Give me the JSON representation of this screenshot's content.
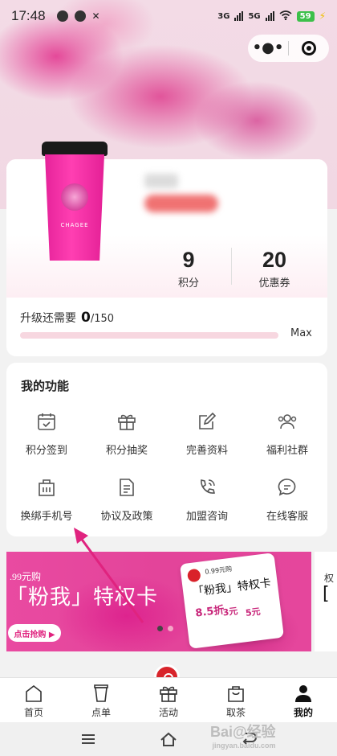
{
  "status_bar": {
    "time": "17:48",
    "net1": "3G",
    "net2": "5G",
    "battery": "59"
  },
  "capsule": {
    "more_glyph": "•●•"
  },
  "member": {
    "cup_brand": "CHAGEE",
    "points_value": "9",
    "points_label": "积分",
    "coupons_value": "20",
    "coupons_label": "优惠券",
    "upgrade_label": "升级还需要",
    "upgrade_current": "0",
    "upgrade_total": "/150",
    "progress_fraction": 0,
    "max_label": "Max"
  },
  "functions": {
    "title": "我的功能",
    "items": [
      {
        "label": "积分签到",
        "icon": "calendar-check-icon"
      },
      {
        "label": "积分抽奖",
        "icon": "gift-icon"
      },
      {
        "label": "完善资料",
        "icon": "edit-icon"
      },
      {
        "label": "福利社群",
        "icon": "group-icon"
      },
      {
        "label": "换绑手机号",
        "icon": "phone-swap-icon"
      },
      {
        "label": "协议及政策",
        "icon": "document-icon"
      },
      {
        "label": "加盟咨询",
        "icon": "call-icon"
      },
      {
        "label": "在线客服",
        "icon": "chat-icon"
      }
    ]
  },
  "banner": {
    "price_text": ".99元购",
    "title": "「粉我」特权卡",
    "button": "点击抢购 ▶",
    "card_sub": "0.99元购",
    "card_title": "「粉我」特权卡",
    "card_a": "8.5折",
    "card_b": "3元",
    "card_c": "5元",
    "peek_small": "权",
    "peek_big": "["
  },
  "tabs": [
    {
      "label": "首页",
      "icon": "home-icon"
    },
    {
      "label": "点单",
      "icon": "cup-icon"
    },
    {
      "label": "活动",
      "icon": "gift-icon"
    },
    {
      "label": "取茶",
      "icon": "bag-icon"
    },
    {
      "label": "我的",
      "icon": "person-icon"
    }
  ],
  "watermark": {
    "main": "Bai@经验",
    "sub": "jingyan.baidu.com"
  },
  "colors": {
    "accent": "#e64a86",
    "brand_pink": "#e6239a",
    "badge_red": "#d8242b"
  }
}
